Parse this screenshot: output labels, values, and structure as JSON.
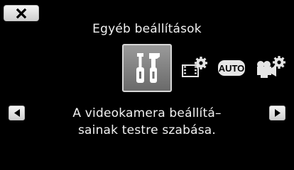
{
  "header": {
    "close_icon": "close-icon"
  },
  "menu": {
    "title": "Egyéb beállítások",
    "icons": [
      {
        "name": "tools-icon",
        "selected": true
      },
      {
        "name": "movie-settings-icon",
        "selected": false
      },
      {
        "name": "auto-icon",
        "label": "AUTO",
        "selected": false
      },
      {
        "name": "camera-settings-icon",
        "selected": false
      }
    ]
  },
  "navigation": {
    "prev_icon": "triangle-left-icon",
    "next_icon": "triangle-right-icon"
  },
  "description": {
    "line1": "A videokamera beállítá–",
    "line2": "sainak testre szabása."
  },
  "colors": {
    "background": "#000000",
    "text": "#f2f2f2",
    "button_face": "#e6e6e6",
    "selected_tile": "#808080"
  }
}
